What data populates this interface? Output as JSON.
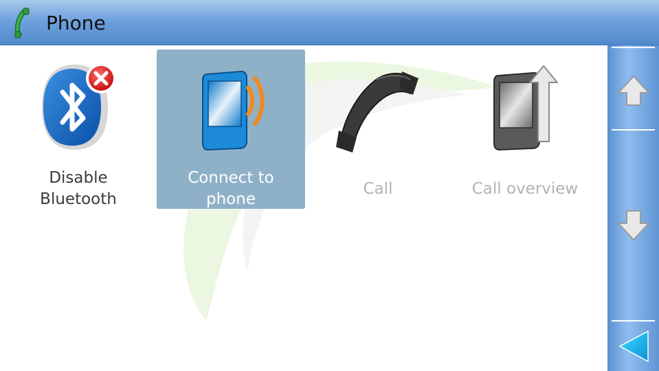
{
  "header": {
    "title": "Phone",
    "icon": "phone-handset-icon"
  },
  "tiles": [
    {
      "label": "Disable\nBluetooth",
      "icon": "bluetooth-disable-icon",
      "state": "enabled"
    },
    {
      "label": "Connect to\nphone",
      "icon": "connect-phone-icon",
      "state": "selected"
    },
    {
      "label": "Call",
      "icon": "call-handset-icon",
      "state": "disabled"
    },
    {
      "label": "Call overview",
      "icon": "call-overview-icon",
      "state": "disabled"
    }
  ],
  "scrollbar": {
    "up": "arrow-up-icon",
    "down": "arrow-down-icon",
    "back": "back-arrow-icon"
  },
  "colors": {
    "header": "#5e94d4",
    "selected_tile": "#8fb1c8",
    "scrollbar": "#6aa0dc",
    "disabled_text": "#b3b3b3"
  }
}
